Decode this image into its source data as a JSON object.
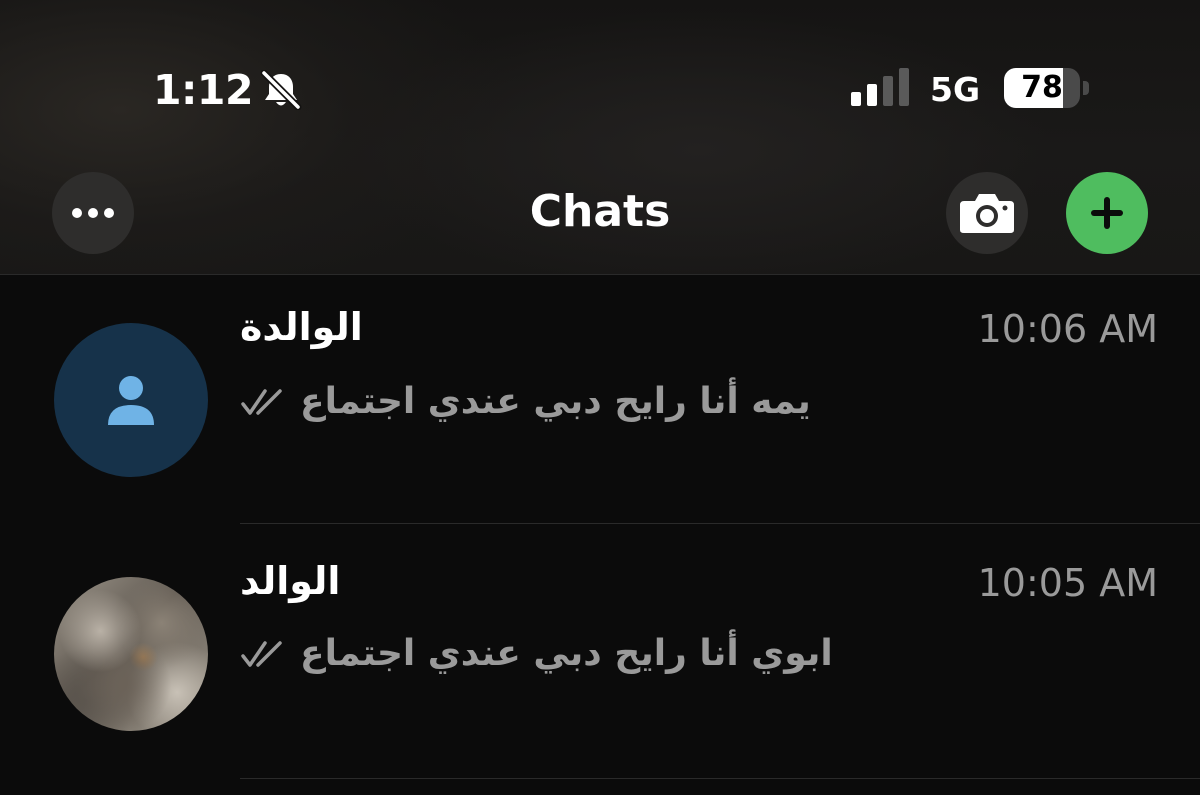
{
  "status_bar": {
    "time": "1:12",
    "silent_icon": "bell-slash-icon",
    "signal_icon": "cellular-signal-icon",
    "signal_bars_active": 2,
    "signal_bars_total": 4,
    "network": "5G",
    "battery_percent": "78",
    "battery_level": 0.78
  },
  "nav": {
    "title": "Chats",
    "more_icon": "ellipsis-icon",
    "camera_icon": "camera-icon",
    "new_chat_icon": "plus-icon",
    "accent_color": "#4fbd5f"
  },
  "chats": [
    {
      "name": "الوالدة",
      "time": "10:06 AM",
      "preview": "يمه أنا رايح دبي عندي اجتماع",
      "status_icon": "double-check-icon",
      "avatar": "default-person-icon"
    },
    {
      "name": "الوالد",
      "time": "10:05 AM",
      "preview": "ابوي أنا رايح دبي عندي اجتماع",
      "status_icon": "double-check-icon",
      "avatar": "profile-photo"
    }
  ],
  "colors": {
    "background": "#0b0b0b",
    "secondary_text": "#9a9a9a",
    "default_avatar_bg": "#16324a",
    "default_avatar_icon": "#6fb3e6"
  }
}
